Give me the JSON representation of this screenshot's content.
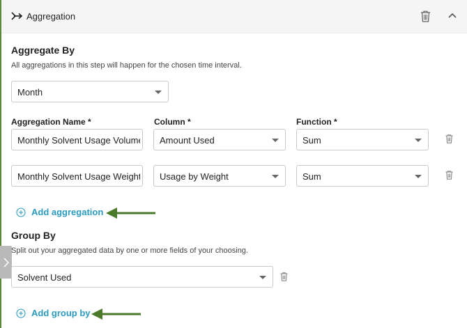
{
  "header": {
    "title": "Aggregation"
  },
  "aggregate_by": {
    "title": "Aggregate By",
    "helper": "All aggregations in this step will happen for the chosen time interval.",
    "interval_value": "Month"
  },
  "aggregations": {
    "name_label": "Aggregation Name *",
    "column_label": "Column *",
    "function_label": "Function *",
    "rows": [
      {
        "name": "Monthly Solvent Usage Volume",
        "column": "Amount Used",
        "function": "Sum"
      },
      {
        "name": "Monthly Solvent Usage Weight",
        "column": "Usage by Weight",
        "function": "Sum"
      }
    ],
    "add_label": "Add aggregation"
  },
  "group_by": {
    "title": "Group By",
    "helper": "Split out your aggregated data by one or more fields of your choosing.",
    "field_value": "Solvent Used",
    "add_label": "Add group by"
  },
  "colors": {
    "accent": "#2b9bc0",
    "arrow": "#4a7a2a",
    "rail": "#5a8a36"
  }
}
